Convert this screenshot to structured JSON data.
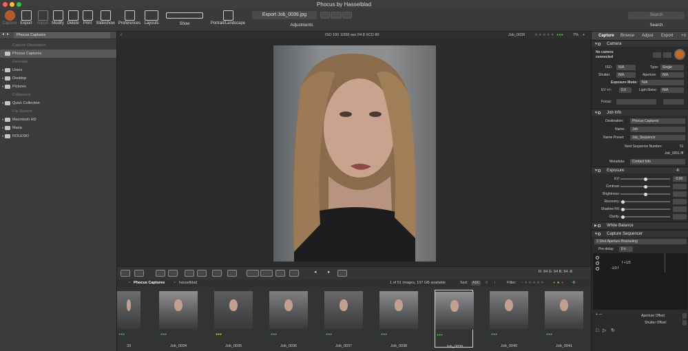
{
  "window": {
    "title": "Phocus by Hasselblad"
  },
  "toolbar": {
    "capture": "Capture",
    "export": "Export",
    "import": "Import",
    "modify": "Modify",
    "delete": "Delete",
    "print": "Print",
    "slideshow": "Slideshow",
    "preferences": "Preferences",
    "layouts": "Layouts",
    "show": "Show",
    "portrait_landscape": "Portrait/Landscape",
    "doc_title": "Export Job_0039.jpg",
    "adjustments": "Adjustments",
    "search_placeholder": "Search",
    "search_label": "Search"
  },
  "left": {
    "source": "Phocus Captures",
    "rows": [
      {
        "label": "Capture Destination",
        "type": "hdr"
      },
      {
        "label": "Phocus Captures",
        "type": "sel"
      },
      {
        "label": "Favorites",
        "type": "hdr"
      },
      {
        "label": "Users",
        "type": "item"
      },
      {
        "label": "Desktop",
        "type": "item"
      },
      {
        "label": "Pictures",
        "type": "item"
      },
      {
        "label": "Collections",
        "type": "hdr"
      },
      {
        "label": "Quick Collection",
        "type": "item"
      },
      {
        "label": "File System",
        "type": "hdr"
      },
      {
        "label": "Macintosh HD",
        "type": "item"
      },
      {
        "label": "Maria",
        "type": "item"
      },
      {
        "label": "ROLESKI",
        "type": "item"
      }
    ]
  },
  "info": {
    "exposure": "ISO 100  1/350 sec  f/4.8  XCD 80",
    "job": "Job_0039",
    "zoom": "7%"
  },
  "readout": {
    "text": "R:  94  G:  94  B:  94  -8"
  },
  "filter": {
    "tab1": "Phocus Captures",
    "tab2": "hasselblad",
    "count": "1 of 51 images, 107 GB available",
    "sort": "Sort:",
    "asc": "ASC",
    "filter": "Filter:",
    "filter_num": "-8"
  },
  "thumbs": [
    "33",
    "Job_0034",
    "Job_0035",
    "Job_0036",
    "Job_0037",
    "Job_0038",
    "Job_0039",
    "Job_0040",
    "Job_0041"
  ],
  "right": {
    "tabs": [
      "Capture",
      "Browse",
      "Adjust",
      "Export"
    ],
    "camera": {
      "title": "Camera",
      "status": "No camera\nconnected",
      "iso_l": "ISO:",
      "iso_v": "N/A",
      "type_l": "Type:",
      "type_v": "Single",
      "shutter_l": "Shutter:",
      "shutter_v": "N/A",
      "aperture_l": "Aperture:",
      "aperture_v": "N/A",
      "mode_l": "Exposure Mode:",
      "mode_v": "N/A",
      "ev_l": "EV +/-:",
      "ev_v": "0,0",
      "meter_l": "Light Meter:",
      "meter_v": "N/A",
      "focus_l": "Focus:"
    },
    "jobinfo": {
      "title": "Job Info",
      "dest_l": "Destination:",
      "dest_v": "Phocus Captures",
      "name_l": "Name:",
      "name_v": "Job",
      "preset_l": "Name Preset:",
      "preset_v": "Job_Sequence",
      "seq_l": "Next Sequence Number:",
      "seq_v": "51",
      "fname": "Job_0051.fff",
      "meta_l": "Metadata:",
      "meta_v": "Contact Info"
    },
    "exposure": {
      "title": "Exposure",
      "ev": "EV:",
      "ev_v": "-0,60",
      "contrast": "Contrast:",
      "brightness": "Brightness:",
      "recovery": "Recovery:",
      "shadow": "Shadow Fill:",
      "clarity": "Clarity:",
      "levels": {
        "ev": 0.5,
        "contrast": 0.5,
        "brightness": 0.5,
        "recovery": 0.05,
        "shadow": 0.05,
        "clarity": 0.05
      }
    },
    "wb": {
      "title": "White Balance"
    },
    "seq": {
      "title": "Capture Sequencer",
      "mode": "3 Shot Aperture Bracketing",
      "predelay_l": "Pre-delay:",
      "predelay_v": "0 s",
      "step1": "f +1/3",
      "step2": "-1/3 f",
      "ap_off": "Aperture Offset:",
      "sh_off": "Shutter Offset:"
    }
  }
}
